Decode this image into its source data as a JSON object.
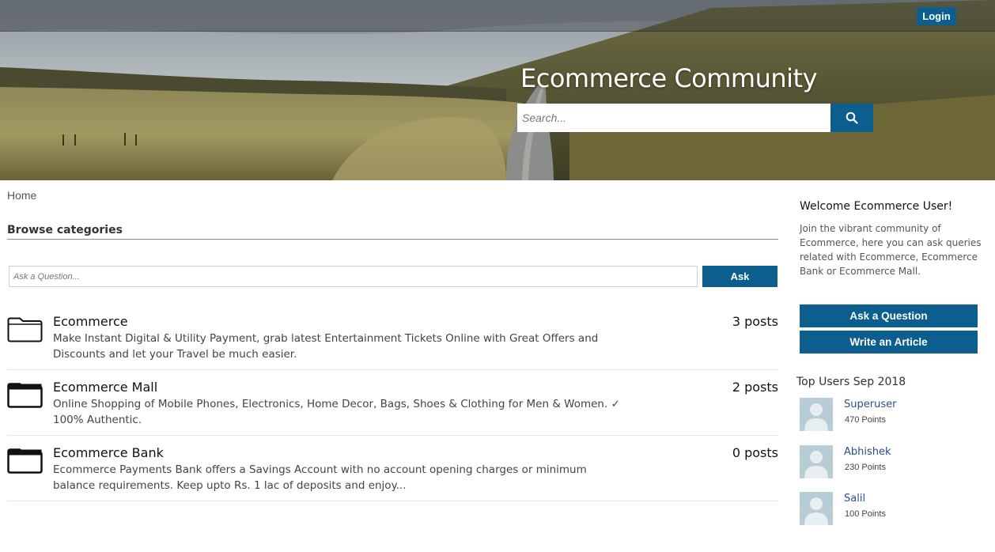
{
  "header": {
    "login_label": "Login",
    "title": "Ecommerce Community",
    "search_placeholder": "Search..."
  },
  "breadcrumb": "Home",
  "section_title": "Browse categories",
  "ask": {
    "placeholder": "Ask a Question...",
    "button_label": "Ask"
  },
  "categories": [
    {
      "name": "Ecommerce",
      "description": "Make Instant Digital & Utility Payment, grab latest Entertainment Tickets Online with Great Offers and Discounts and let your Travel be much easier.",
      "posts": "3 posts",
      "icon": "folder-outline-icon"
    },
    {
      "name": "Ecommerce Mall",
      "description": "Online Shopping of Mobile Phones, Electronics, Home Decor, Bags, Shoes & Clothing for Men & Women. ✓ 100% Authentic.",
      "posts": "2 posts",
      "icon": "folder-filled-icon"
    },
    {
      "name": "Ecommerce Bank",
      "description": "Ecommerce Payments Bank offers a Savings Account with no account opening charges or minimum balance requirements. Keep upto Rs. 1 lac of deposits and enjoy...",
      "posts": "0 posts",
      "icon": "folder-filled-icon"
    }
  ],
  "sidebar": {
    "welcome_title": "Welcome Ecommerce User!",
    "welcome_text": "Join the vibrant community of Ecommerce, here you can ask queries related with Ecommerce, Ecommerce Bank or Ecommerce Mall.",
    "ask_question_label": "Ask a Question",
    "write_article_label": "Write an Article",
    "top_users_title": "Top Users Sep 2018",
    "top_users": [
      {
        "name": "Superuser",
        "points": "470 Points"
      },
      {
        "name": "Abhishek",
        "points": "230 Points"
      },
      {
        "name": "Salil",
        "points": "100 Points"
      }
    ]
  },
  "colors": {
    "primary": "#0b5e8e",
    "user_link": "#2c4f86"
  }
}
